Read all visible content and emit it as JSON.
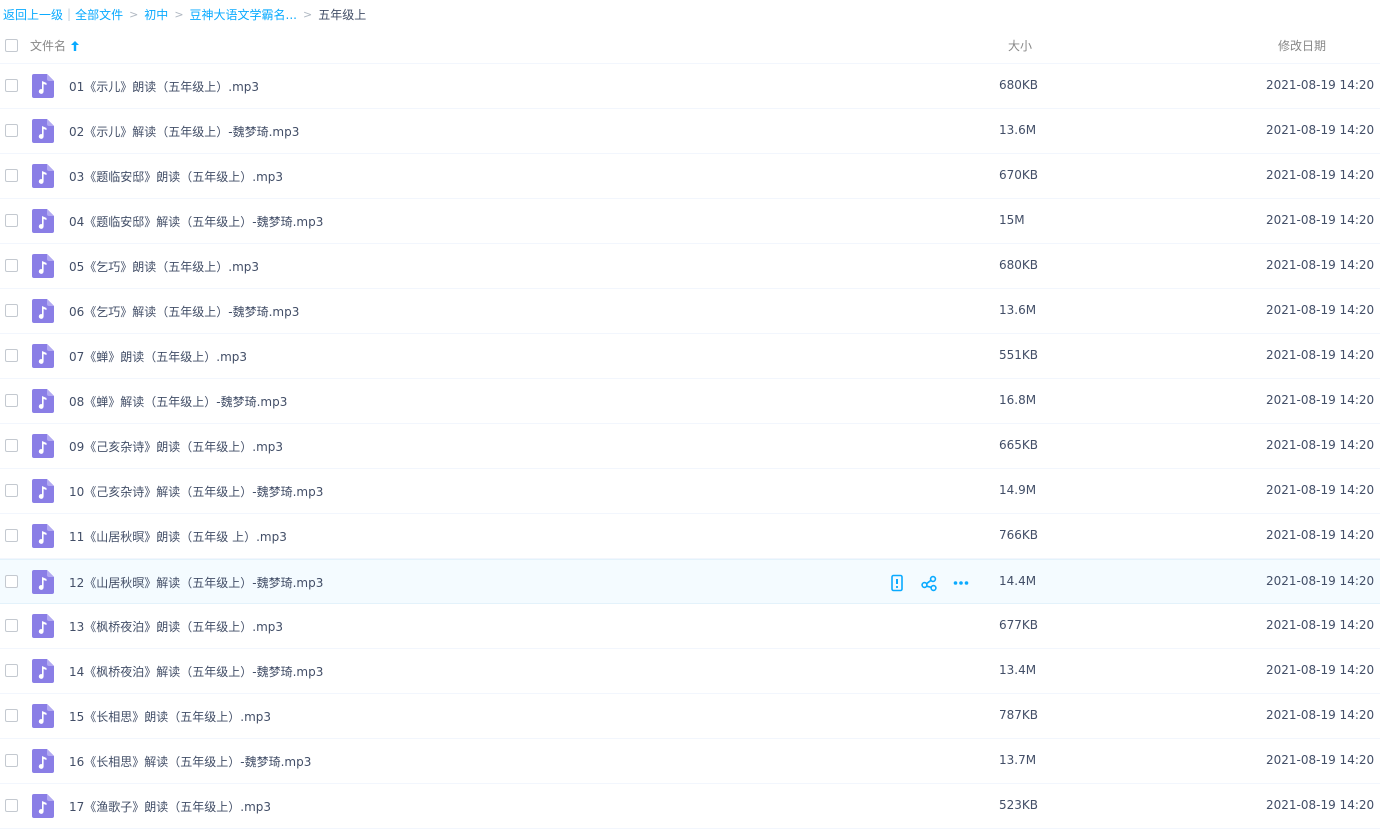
{
  "breadcrumb": {
    "back": "返回上一级",
    "all_files": "全部文件",
    "level1": "初中",
    "level2": "豆神大语文学霸名...",
    "current": "五年级上",
    "arrow": ">"
  },
  "header": {
    "name_label": "文件名",
    "size_label": "大小",
    "date_label": "修改日期"
  },
  "colors": {
    "accent": "#09aaff",
    "audio_icon": "#8a7ee6",
    "hover_row": "#f4fbff"
  },
  "files": [
    {
      "name": "01《示儿》朗读（五年级上）.mp3",
      "size": "680KB",
      "date": "2021-08-19 14:20"
    },
    {
      "name": "02《示儿》解读（五年级上）-魏梦琦.mp3",
      "size": "13.6M",
      "date": "2021-08-19 14:20"
    },
    {
      "name": "03《题临安邸》朗读（五年级上）.mp3",
      "size": "670KB",
      "date": "2021-08-19 14:20"
    },
    {
      "name": "04《题临安邸》解读（五年级上）-魏梦琦.mp3",
      "size": "15M",
      "date": "2021-08-19 14:20"
    },
    {
      "name": "05《乞巧》朗读（五年级上）.mp3",
      "size": "680KB",
      "date": "2021-08-19 14:20"
    },
    {
      "name": "06《乞巧》解读（五年级上）-魏梦琦.mp3",
      "size": "13.6M",
      "date": "2021-08-19 14:20"
    },
    {
      "name": "07《蝉》朗读（五年级上）.mp3",
      "size": "551KB",
      "date": "2021-08-19 14:20"
    },
    {
      "name": "08《蝉》解读（五年级上）-魏梦琦.mp3",
      "size": "16.8M",
      "date": "2021-08-19 14:20"
    },
    {
      "name": "09《己亥杂诗》朗读（五年级上）.mp3",
      "size": "665KB",
      "date": "2021-08-19 14:20"
    },
    {
      "name": "10《己亥杂诗》解读（五年级上）-魏梦琦.mp3",
      "size": "14.9M",
      "date": "2021-08-19 14:20"
    },
    {
      "name": "11《山居秋暝》朗读（五年级 上）.mp3",
      "size": "766KB",
      "date": "2021-08-19 14:20"
    },
    {
      "name": "12《山居秋暝》解读（五年级上）-魏梦琦.mp3",
      "size": "14.4M",
      "date": "2021-08-19 14:20",
      "hover": true
    },
    {
      "name": "13《枫桥夜泊》朗读（五年级上）.mp3",
      "size": "677KB",
      "date": "2021-08-19 14:20"
    },
    {
      "name": "14《枫桥夜泊》解读（五年级上）-魏梦琦.mp3",
      "size": "13.4M",
      "date": "2021-08-19 14:20"
    },
    {
      "name": "15《长相思》朗读（五年级上）.mp3",
      "size": "787KB",
      "date": "2021-08-19 14:20"
    },
    {
      "name": "16《长相思》解读（五年级上）-魏梦琦.mp3",
      "size": "13.7M",
      "date": "2021-08-19 14:20"
    },
    {
      "name": "17《渔歌子》朗读（五年级上）.mp3",
      "size": "523KB",
      "date": "2021-08-19 14:20"
    }
  ]
}
